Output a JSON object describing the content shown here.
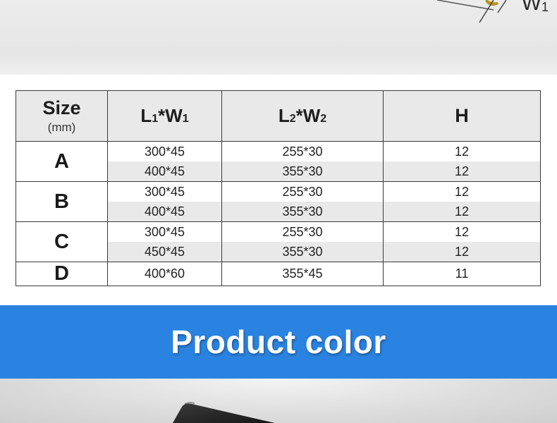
{
  "illustration": {
    "dimension_label_main": "W",
    "dimension_label_sub": "1"
  },
  "table": {
    "headers": [
      {
        "main": "Size",
        "sub": "(mm)"
      },
      {
        "a": "L",
        "a_sub": "1",
        "mid": "*W",
        "b_sub": "1"
      },
      {
        "a": "L",
        "a_sub": "2",
        "mid": "*W",
        "b_sub": "2"
      },
      {
        "main": "H"
      }
    ],
    "groups": [
      {
        "label": "A",
        "rows": [
          [
            "300*45",
            "255*30",
            "12"
          ],
          [
            "400*45",
            "355*30",
            "12"
          ]
        ]
      },
      {
        "label": "B",
        "rows": [
          [
            "300*45",
            "255*30",
            "12"
          ],
          [
            "400*45",
            "355*30",
            "12"
          ]
        ]
      },
      {
        "label": "C",
        "rows": [
          [
            "300*45",
            "255*30",
            "12"
          ],
          [
            "450*45",
            "355*30",
            "12"
          ]
        ]
      },
      {
        "label": "D",
        "rows": [
          [
            "400*60",
            "355*45",
            "11"
          ]
        ]
      }
    ]
  },
  "banner": {
    "title": "Product color",
    "color": "#2a83e0"
  },
  "colors": {
    "header_bg": "#e9e9e9",
    "border": "#3a3a3a",
    "alt_row": "#e9e9e9"
  }
}
